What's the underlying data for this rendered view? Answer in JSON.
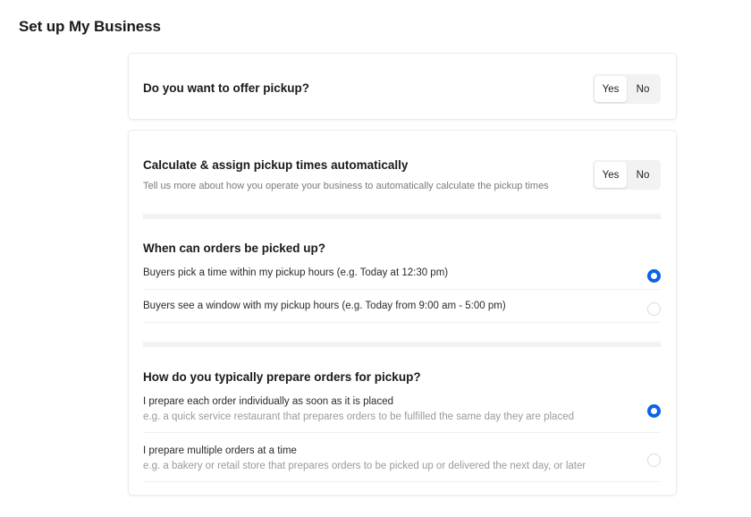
{
  "page": {
    "title": "Set up My Business"
  },
  "pickup": {
    "question": "Do you want to offer pickup?",
    "options": [
      {
        "label": "Yes",
        "selected": true
      },
      {
        "label": "No",
        "selected": false
      }
    ]
  },
  "auto_assign": {
    "question": "Calculate & assign pickup times automatically",
    "description": "Tell us more about how you operate your business to automatically calculate the pickup times",
    "options": [
      {
        "label": "Yes",
        "selected": true
      },
      {
        "label": "No",
        "selected": false
      }
    ]
  },
  "pickup_time": {
    "question": "When can orders be picked up?",
    "options": [
      {
        "label": "Buyers pick a time within my pickup hours (e.g. Today at 12:30 pm)",
        "selected": true
      },
      {
        "label": "Buyers see a window with my pickup hours (e.g. Today from 9:00 am - 5:00 pm)",
        "selected": false
      }
    ]
  },
  "preparation": {
    "question": "How do you typically prepare orders for pickup?",
    "options": [
      {
        "label": "I prepare each order individually as soon as it is placed",
        "hint": "e.g. a quick service restaurant that prepares orders to be fulfilled the same day they are placed",
        "selected": true
      },
      {
        "label": "I prepare multiple orders at a time",
        "hint": "e.g. a bakery or retail store that prepares orders to be picked up or delivered the next day, or later",
        "selected": false
      }
    ]
  },
  "colors": {
    "accent": "#0b63e5",
    "segment_bg": "#f2f2f2"
  }
}
